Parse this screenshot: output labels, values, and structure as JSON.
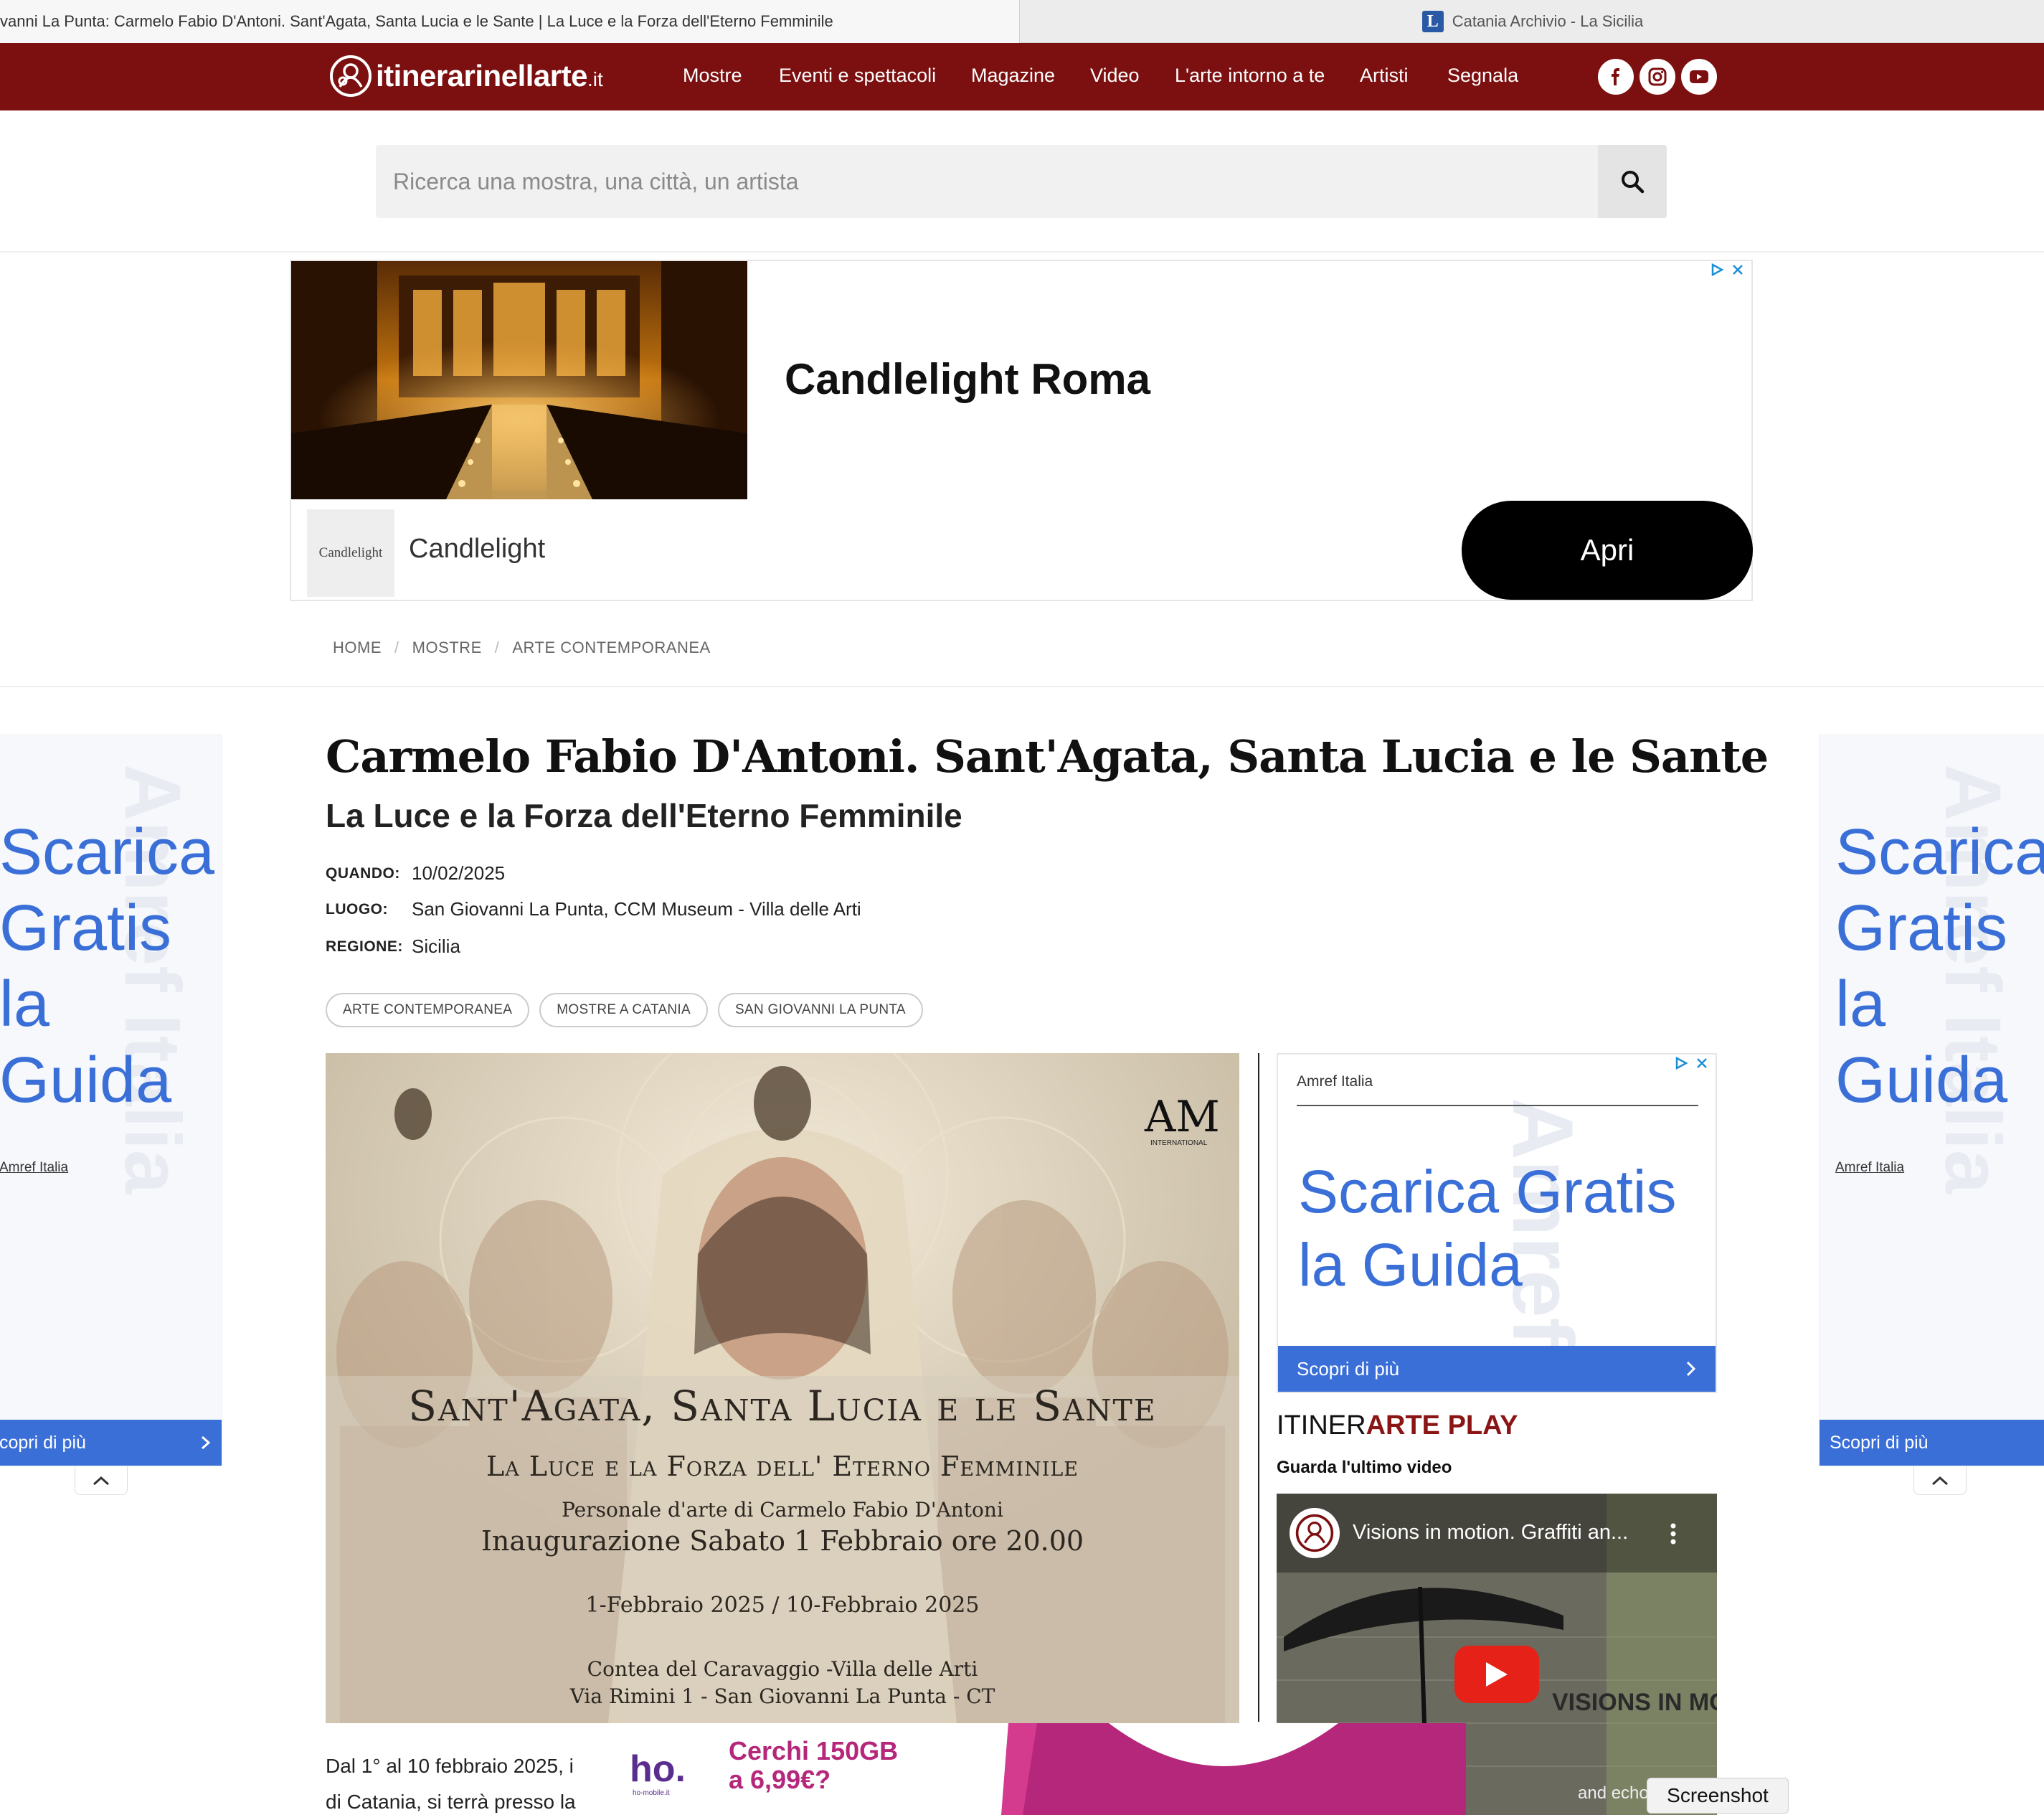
{
  "browser": {
    "active_tab": "vanni La Punta: Carmelo Fabio D'Antoni. Sant'Agata, Santa Lucia e le Sante | La Luce e la Forza dell'Eterno Femminile",
    "other_tab": "Catania Archivio - La Sicilia",
    "other_tab_favicon": "L"
  },
  "site": {
    "logo_main": "itinerarinellarte",
    "logo_tld": ".it",
    "brand_color": "#7c1010"
  },
  "nav": {
    "items": [
      "Mostre",
      "Eventi e spettacoli",
      "Magazine",
      "Video",
      "L'arte intorno a te",
      "Artisti",
      "Segnala"
    ],
    "social": [
      "facebook-icon",
      "instagram-icon",
      "youtube-icon"
    ]
  },
  "search": {
    "placeholder": "Ricerca una mostra, una città, un artista"
  },
  "ad_top": {
    "title": "Candlelight Roma",
    "logo_text": "Candlelight",
    "brand": "Candlelight",
    "button": "Apri"
  },
  "breadcrumb": [
    "HOME",
    "MOSTRE",
    "ARTE CONTEMPORANEA"
  ],
  "article": {
    "title": "Carmelo Fabio D'Antoni. Sant'Agata, Santa Lucia e le Sante",
    "subtitle": "La Luce e la Forza dell'Eterno Femminile",
    "when_label": "QUANDO:",
    "when": "10/02/2025",
    "where_label": "LUOGO:",
    "where": "San Giovanni La Punta, CCM Museum - Villa delle Arti",
    "region_label": "REGIONE:",
    "region": "Sicilia",
    "tags": [
      "ARTE CONTEMPORANEA",
      "MOSTRE A CATANIA",
      "SAN GIOVANNI LA PUNTA"
    ],
    "body_line1": "Dal 1° al 10 febbraio 2025, i",
    "body_line2": "di Catania, si terrà presso la"
  },
  "poster": {
    "logo_right": "AM",
    "logo_right_sub": "INTERNATIONAL",
    "line1": "Sant'Agata, Santa Lucia e le Sante",
    "line2": "La Luce e la Forza dell' Eterno Femminile",
    "line3": "Personale d'arte di Carmelo Fabio D'Antoni",
    "line4": "Inaugurazione Sabato 1 Febbraio ore 20.00",
    "line5": "1-Febbraio 2025 / 10-Febbraio 2025",
    "line6": "Contea del Caravaggio -Villa delle Arti",
    "line7": "Via Rimini 1 - San Giovanni La Punta - CT"
  },
  "ad_side": {
    "sponsor": "Amref Italia",
    "headline_1": "Scarica Gratis",
    "headline_2": "la Guida",
    "cta": "Scopri di più",
    "accent": "#3a6fd8"
  },
  "play": {
    "head_a": "ITINER",
    "head_b": "ARTE",
    "head_c": " PLAY",
    "sub": "Guarda l'ultimo video",
    "video_title": "Visions in motion. Graffiti an...",
    "overlay_1": "VISIONS IN MO",
    "overlay_2": "and echo"
  },
  "sky_left": {
    "words": [
      "Scarica",
      "Gratis",
      "la",
      "Guida"
    ],
    "sponsor": "Amref Italia",
    "cta": "copri di più"
  },
  "sky_right": {
    "words": [
      "Scarica",
      "Gratis",
      "la",
      "Guida"
    ],
    "sponsor": "Amref Italia",
    "cta": "Scopri di più"
  },
  "ad_bottom": {
    "brand": "ho.",
    "brand_sub": "ho-mobile.it",
    "line1": "Cerchi 150GB",
    "line2": "a 6,99€?"
  },
  "overlay": {
    "screenshot": "Screenshot"
  }
}
